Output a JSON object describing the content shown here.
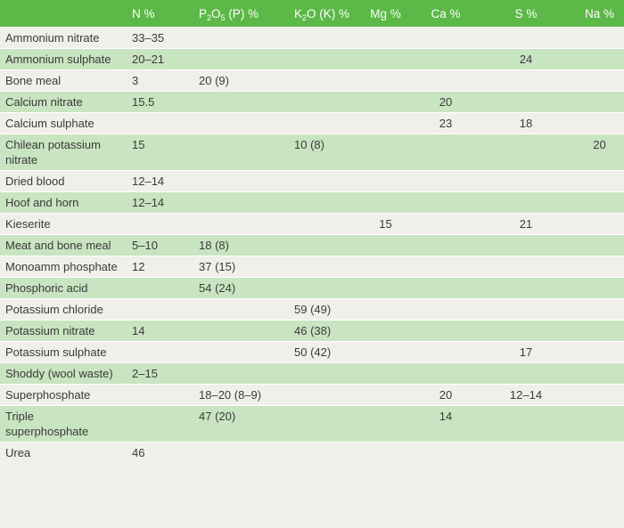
{
  "headers": {
    "blank": "",
    "n": "N %",
    "p": {
      "a": "P",
      "a_sub": "2",
      "b": "O",
      "b_sub": "5",
      "rest": " (P) %"
    },
    "k": {
      "a": "K",
      "a_sub": "2",
      "rest": "O (K) %"
    },
    "mg": "Mg %",
    "ca": "Ca %",
    "s": "S %",
    "na": "Na %"
  },
  "colors": {
    "header": "#5cb847",
    "row_light": "#f1efea",
    "row_green": "#c9e4c0"
  },
  "rows": [
    {
      "name": "Ammonium nitrate",
      "n": "33–35",
      "p": "",
      "k": "",
      "mg": "",
      "ca": "",
      "s": "",
      "na": ""
    },
    {
      "name": "Ammonium sulphate",
      "n": "20–21",
      "p": "",
      "k": "",
      "mg": "",
      "ca": "",
      "s": "24",
      "na": ""
    },
    {
      "name": "Bone meal",
      "n": "3",
      "p": "20 (9)",
      "k": "",
      "mg": "",
      "ca": "",
      "s": "",
      "na": ""
    },
    {
      "name": "Calcium nitrate",
      "n": "15.5",
      "p": "",
      "k": "",
      "mg": "",
      "ca": "20",
      "s": "",
      "na": ""
    },
    {
      "name": "Calcium sulphate",
      "n": "",
      "p": "",
      "k": "",
      "mg": "",
      "ca": "23",
      "s": "18",
      "na": ""
    },
    {
      "name": "Chilean potassium nitrate",
      "n": "15",
      "p": "",
      "k": "10 (8)",
      "mg": "",
      "ca": "",
      "s": "",
      "na": "20"
    },
    {
      "name": "Dried blood",
      "n": "12–14",
      "p": "",
      "k": "",
      "mg": "",
      "ca": "",
      "s": "",
      "na": ""
    },
    {
      "name": "Hoof and horn",
      "n": "12–14",
      "p": "",
      "k": "",
      "mg": "",
      "ca": "",
      "s": "",
      "na": ""
    },
    {
      "name": "Kieserite",
      "n": "",
      "p": "",
      "k": "",
      "mg": "15",
      "ca": "",
      "s": "21",
      "na": ""
    },
    {
      "name": "Meat and bone meal",
      "n": "5–10",
      "p": "18 (8)",
      "k": "",
      "mg": "",
      "ca": "",
      "s": "",
      "na": ""
    },
    {
      "name": "Monoamm phosphate",
      "n": "12",
      "p": "37 (15)",
      "k": "",
      "mg": "",
      "ca": "",
      "s": "",
      "na": ""
    },
    {
      "name": "Phosphoric acid",
      "n": "",
      "p": "54 (24)",
      "k": "",
      "mg": "",
      "ca": "",
      "s": "",
      "na": ""
    },
    {
      "name": "Potassium chloride",
      "n": "",
      "p": "",
      "k": "59 (49)",
      "mg": "",
      "ca": "",
      "s": "",
      "na": ""
    },
    {
      "name": "Potassium nitrate",
      "n": "14",
      "p": "",
      "k": "46 (38)",
      "mg": "",
      "ca": "",
      "s": "",
      "na": ""
    },
    {
      "name": "Potassium sulphate",
      "n": "",
      "p": "",
      "k": "50 (42)",
      "mg": "",
      "ca": "",
      "s": "17",
      "na": ""
    },
    {
      "name": "Shoddy (wool waste)",
      "n": "2–15",
      "p": "",
      "k": "",
      "mg": "",
      "ca": "",
      "s": "",
      "na": ""
    },
    {
      "name": "Superphosphate",
      "n": "",
      "p": "18–20 (8–9)",
      "k": "",
      "mg": "",
      "ca": "20",
      "s": "12–14",
      "na": ""
    },
    {
      "name": "Triple superphosphate",
      "n": "",
      "p": "47 (20)",
      "k": "",
      "mg": "",
      "ca": "14",
      "s": "",
      "na": ""
    },
    {
      "name": "Urea",
      "n": "46",
      "p": "",
      "k": "",
      "mg": "",
      "ca": "",
      "s": "",
      "na": ""
    }
  ]
}
